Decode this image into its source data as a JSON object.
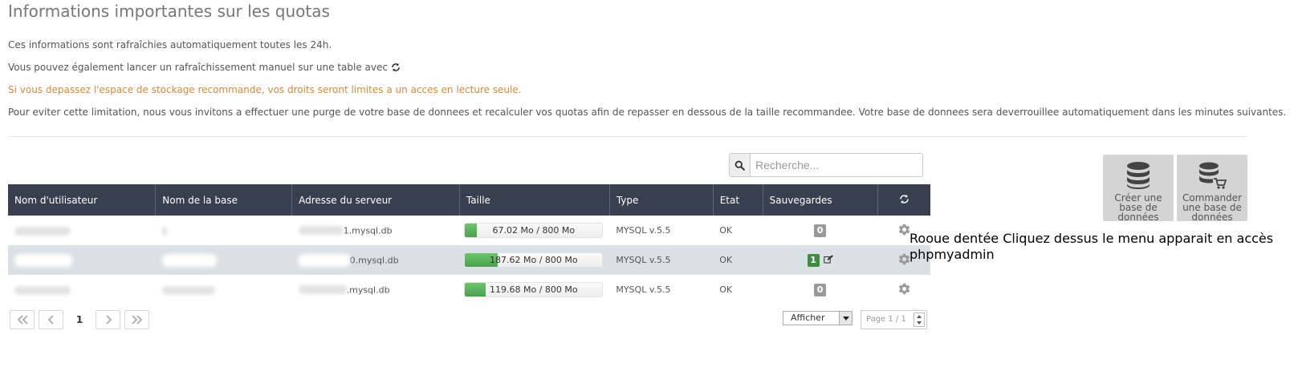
{
  "page": {
    "title": "Informations importantes sur les quotas",
    "info1": "Ces informations sont rafraîchies automatiquement toutes les 24h.",
    "info2": "Vous pouvez également lancer un rafraîchissement manuel sur une table avec",
    "warning": "Si vous depassez l'espace de stockage recommande, vos droits seront limites a un acces en lecture seule.",
    "info3": "Pour eviter cette limitation, nous vous invitons a effectuer une purge de votre base de donnees et recalculer vos quotas afin de repasser en dessous de la taille recommandee. Votre base de donnees sera deverrouillee automatiquement dans les minutes suivantes."
  },
  "search": {
    "placeholder": "Recherche..."
  },
  "table": {
    "headers": [
      "Nom d'utilisateur",
      "Nom de la base",
      "Adresse du serveur",
      "Taille",
      "Type",
      "Etat",
      "Sauvegardes"
    ],
    "rows": [
      {
        "address_suffix": "1.mysql.db",
        "size_label": "67.02 Mo / 800 Mo",
        "usage": 0.084,
        "type": "MYSQL  v.5.5",
        "state": "OK",
        "backups": "0",
        "backup_status": "none"
      },
      {
        "address_suffix": "0.mysql.db",
        "size_label": "187.62 Mo / 800 Mo",
        "usage": 0.235,
        "type": "MYSQL  v.5.5",
        "state": "OK",
        "backups": "1",
        "backup_status": "available"
      },
      {
        "address_suffix": ".mysql.db",
        "size_label": "119.68 Mo / 800 Mo",
        "usage": 0.15,
        "type": "MYSQL  v.5.5",
        "state": "OK",
        "backups": "0",
        "backup_status": "none"
      }
    ]
  },
  "pagination": {
    "current": "1",
    "select_label": "Afficher",
    "page_info": "Page 1 / 1",
    "first_icon": "double-chevron-left-icon",
    "prev_icon": "chevron-left-icon",
    "next_icon": "chevron-right-icon",
    "last_icon": "double-chevron-right-icon"
  },
  "actions": {
    "create": {
      "label": "Créer une base de données",
      "icon": "database-icon"
    },
    "order": {
      "label": "Commander une base de données",
      "icon": "database-cart-icon"
    }
  },
  "annotation": "Rooue dentée Cliquez dessus le menu apparait en accès phpmyadmin",
  "colors": {
    "header_bg": "#383f4f",
    "progress": "#5cb85c",
    "warning_text": "#d58a3a",
    "badge_success": "#3d8c40",
    "badge_default": "#999999",
    "row_alt": "#d9e0e6"
  }
}
